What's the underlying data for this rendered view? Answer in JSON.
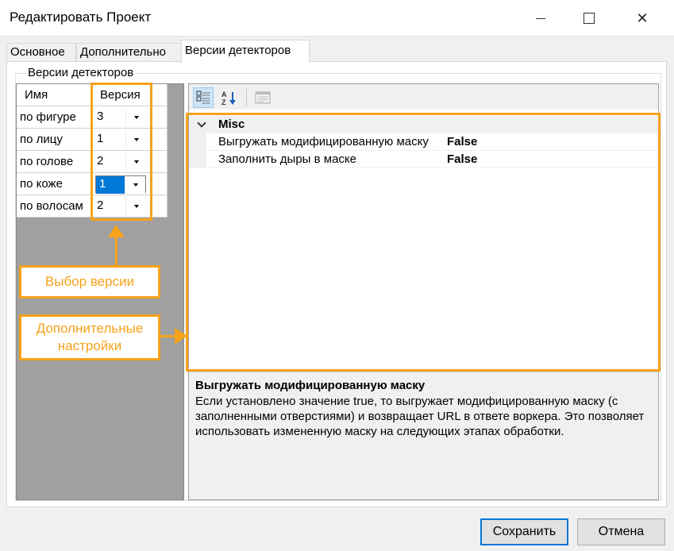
{
  "window": {
    "title": "Редактировать Проект",
    "close_glyph": "✕"
  },
  "tabs": [
    {
      "label": "Основное"
    },
    {
      "label": "Дополнительно"
    },
    {
      "label": "Версии детекторов"
    }
  ],
  "group": {
    "legend": "Версии детекторов"
  },
  "grid": {
    "columns": [
      "Имя",
      "Версия"
    ],
    "rows": [
      {
        "name": "по фигуре",
        "version": "3"
      },
      {
        "name": "по лицу",
        "version": "1"
      },
      {
        "name": "по голове",
        "version": "2"
      },
      {
        "name": "по коже",
        "version": "1"
      },
      {
        "name": "по волосам",
        "version": "2"
      }
    ],
    "selected_row": 3
  },
  "property_grid": {
    "category": "Misc",
    "properties": [
      {
        "name": "Выгружать модифицированную маску",
        "value": "False"
      },
      {
        "name": "Заполнить дыры в маске",
        "value": "False"
      }
    ],
    "description": {
      "title": "Выгружать модифицированную маску",
      "text": "Если установлено значение true, то выгружает модифицированную маску (с заполненными отверстиями) и возвращает URL в ответе воркера. Это позволяет использовать измененную маску на следующих этапах обработки."
    }
  },
  "annotations": {
    "version_select": "Выбор версии",
    "additional_settings": "Дополнительные настройки",
    "accent_color": "#f7a21b"
  },
  "buttons": {
    "save": "Сохранить",
    "cancel": "Отмена"
  }
}
